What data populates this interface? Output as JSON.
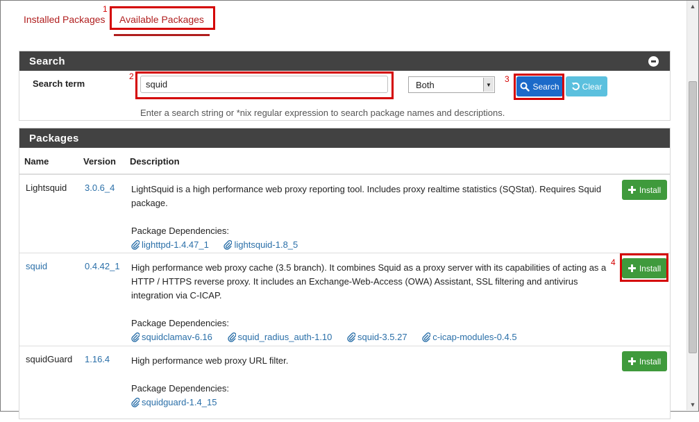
{
  "tabs": {
    "installed": "Installed Packages",
    "available": "Available Packages"
  },
  "annotations": [
    "1",
    "2",
    "3",
    "4"
  ],
  "search": {
    "title": "Search",
    "term_label": "Search term",
    "term_value": "squid",
    "scope_selected": "Both",
    "search_button": "Search",
    "clear_button": "Clear",
    "help": "Enter a search string or *nix regular expression to search package names and descriptions."
  },
  "packages": {
    "title": "Packages",
    "columns": {
      "name": "Name",
      "version": "Version",
      "description": "Description"
    },
    "deps_label": "Package Dependencies:",
    "install_label": "Install",
    "rows": [
      {
        "name": "Lightsquid",
        "version": "3.0.6_4",
        "description": "LightSquid is a high performance web proxy reporting tool. Includes proxy realtime statistics (SQStat). Requires Squid package.",
        "deps": [
          "lighttpd-1.4.47_1",
          "lightsquid-1.8_5"
        ]
      },
      {
        "name": "squid",
        "version": "0.4.42_1",
        "description": "High performance web proxy cache (3.5 branch). It combines Squid as a proxy server with its capabilities of acting as a HTTP / HTTPS reverse proxy. It includes an Exchange-Web-Access (OWA) Assistant, SSL filtering and antivirus integration via C-ICAP.",
        "deps": [
          "squidclamav-6.16",
          "squid_radius_auth-1.10",
          "squid-3.5.27",
          "c-icap-modules-0.4.5"
        ]
      },
      {
        "name": "squidGuard",
        "version": "1.16.4",
        "description": "High performance web proxy URL filter.",
        "deps": [
          "squidguard-1.4_15"
        ]
      }
    ]
  },
  "colors": {
    "tab_red": "#b01e1e",
    "annotation_red": "#d40000",
    "panel_header": "#424242",
    "search_blue": "#1c6ac9",
    "clear_cyan": "#5bc0de",
    "install_green": "#3f9a3c",
    "link_blue": "#2a6fa8"
  }
}
